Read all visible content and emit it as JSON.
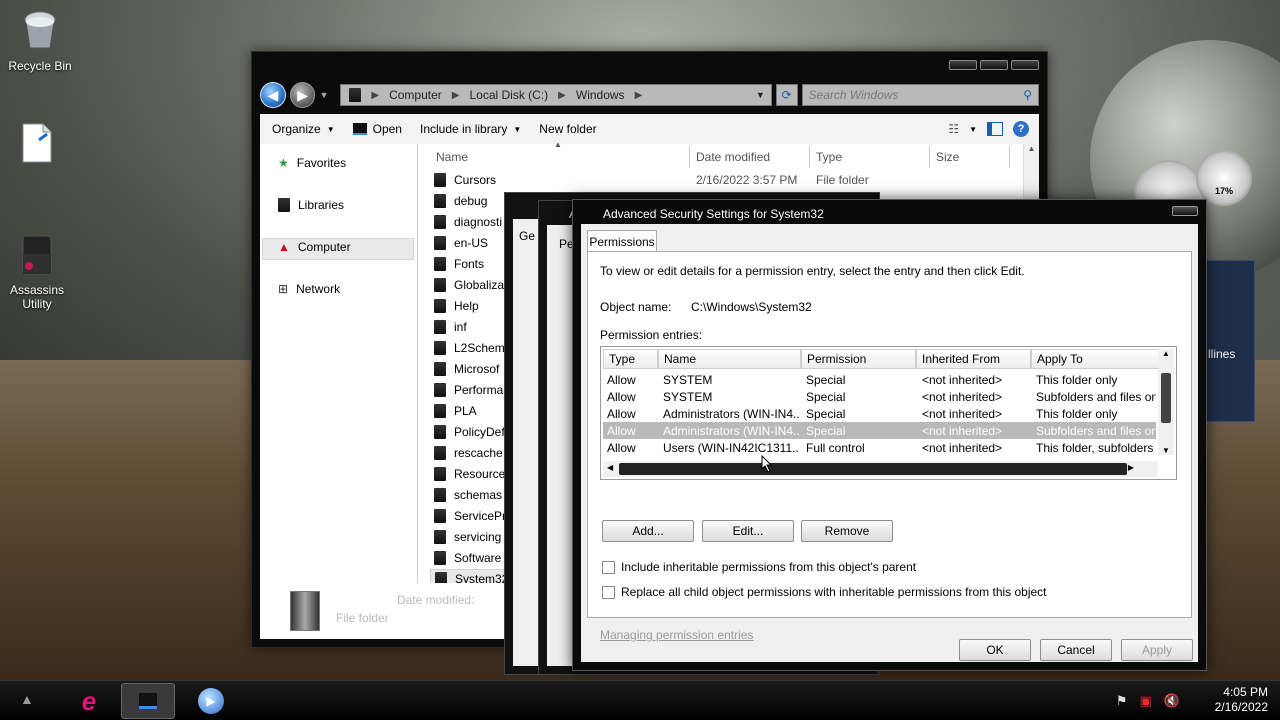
{
  "desktop": {
    "icons": [
      {
        "label": "Recycle Bin"
      },
      {
        "label": ""
      },
      {
        "label": "Assassins Utility"
      }
    ],
    "gadget_text": "llines",
    "gauge_text": "17%"
  },
  "explorer": {
    "breadcrumb": [
      "Computer",
      "Local Disk (C:)",
      "Windows"
    ],
    "search_placeholder": "Search Windows",
    "toolbar": {
      "organize": "Organize",
      "open": "Open",
      "include": "Include in library",
      "new_folder": "New folder"
    },
    "nav": [
      "Favorites",
      "Libraries",
      "Computer",
      "Network"
    ],
    "columns": [
      "Name",
      "Date modified",
      "Type",
      "Size"
    ],
    "files": [
      {
        "name": "Cursors",
        "date": "2/16/2022 3:57 PM",
        "type": "File folder"
      },
      {
        "name": "debug",
        "date": "",
        "type": ""
      },
      {
        "name": "diagnosti",
        "date": "",
        "type": ""
      },
      {
        "name": "en-US",
        "date": "",
        "type": ""
      },
      {
        "name": "Fonts",
        "date": "",
        "type": ""
      },
      {
        "name": "Globaliza",
        "date": "",
        "type": ""
      },
      {
        "name": "Help",
        "date": "",
        "type": ""
      },
      {
        "name": "inf",
        "date": "",
        "type": ""
      },
      {
        "name": "L2Schem",
        "date": "",
        "type": ""
      },
      {
        "name": "Microsof",
        "date": "",
        "type": ""
      },
      {
        "name": "Performa",
        "date": "",
        "type": ""
      },
      {
        "name": "PLA",
        "date": "",
        "type": ""
      },
      {
        "name": "PolicyDef",
        "date": "",
        "type": ""
      },
      {
        "name": "rescache",
        "date": "",
        "type": ""
      },
      {
        "name": "Resource",
        "date": "",
        "type": ""
      },
      {
        "name": "schemas",
        "date": "",
        "type": ""
      },
      {
        "name": "ServicePr",
        "date": "",
        "type": ""
      },
      {
        "name": "servicing",
        "date": "",
        "type": ""
      },
      {
        "name": "Software",
        "date": "",
        "type": ""
      },
      {
        "name": "System32",
        "date": "",
        "type": ""
      }
    ],
    "details": {
      "date_label": "Date modified:",
      "type": "File folder"
    }
  },
  "background_dialogs": {
    "tab1": "Ge",
    "tab2": "Pe",
    "title_a": "A",
    "title_b": "A"
  },
  "dialog": {
    "title": "Advanced Security Settings for System32",
    "tab": "Permissions",
    "intro": "To view or edit details for a permission entry, select the entry and then click Edit.",
    "object_label": "Object name:",
    "object_value": "C:\\Windows\\System32",
    "entries_label": "Permission entries:",
    "columns": [
      "Type",
      "Name",
      "Permission",
      "Inherited From",
      "Apply To"
    ],
    "rows": [
      {
        "type": "Allow",
        "name": "SYSTEM",
        "permission": "Special",
        "inherited": "<not inherited>",
        "apply": "This folder only"
      },
      {
        "type": "Allow",
        "name": "SYSTEM",
        "permission": "Special",
        "inherited": "<not inherited>",
        "apply": "Subfolders and files only"
      },
      {
        "type": "Allow",
        "name": "Administrators (WIN-IN4...",
        "permission": "Special",
        "inherited": "<not inherited>",
        "apply": "This folder only"
      },
      {
        "type": "Allow",
        "name": "Administrators (WIN-IN4...",
        "permission": "Special",
        "inherited": "<not inherited>",
        "apply": "Subfolders and files only"
      },
      {
        "type": "Allow",
        "name": "Users (WIN-IN42IC1311...",
        "permission": "Full control",
        "inherited": "<not inherited>",
        "apply": "This folder, subfolders a..."
      }
    ],
    "buttons": {
      "add": "Add...",
      "edit": "Edit...",
      "remove": "Remove",
      "ok": "OK",
      "cancel": "Cancel",
      "apply": "Apply"
    },
    "checkbox1": "Include inheritable permissions from this object's parent",
    "checkbox2": "Replace all child object permissions with inheritable permissions from this object",
    "link": "Managing permission entries"
  },
  "taskbar": {
    "time": "4:05 PM",
    "date": "2/16/2022"
  }
}
